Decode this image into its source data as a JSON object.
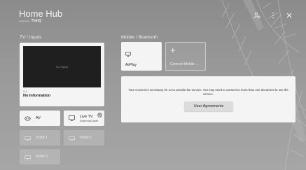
{
  "header": {
    "title": "Home Hub",
    "powered_by": "powered by",
    "brand": "ThinQ"
  },
  "top_icons": [
    "user-settings-icon",
    "more-vertical-icon",
    "close-icon"
  ],
  "tv_inputs": {
    "section_title": "TV / Inputs",
    "preview": {
      "status": "No Signal",
      "channel": "2-1",
      "info": "No Information"
    },
    "tiles": [
      {
        "label": "AV",
        "icon": "av-icon"
      },
      {
        "label": "Live TV",
        "sublabel": "Antenna/Cable",
        "icon": "tv-icon",
        "checked": true
      }
    ],
    "hdmi": [
      {
        "label": "HDMI 1"
      },
      {
        "label": "HDMI 2"
      },
      {
        "label": "HDMI 3"
      }
    ]
  },
  "mobile": {
    "section_title": "Mobile / Bluetooth",
    "airplay": {
      "label": "AirPlay",
      "icon": "airplay-icon"
    },
    "connect": {
      "label": "Connect Mobile ...",
      "icon": "plus-icon"
    },
    "consent": {
      "text": "Your consent is necessary for us to provide the service. You may need to consent to more than one document to use the service.",
      "button": "User Agreements"
    }
  },
  "colors": {
    "background": "#9a9a9a",
    "card": "#f4f4f4",
    "screen": "#1f1f1f"
  }
}
